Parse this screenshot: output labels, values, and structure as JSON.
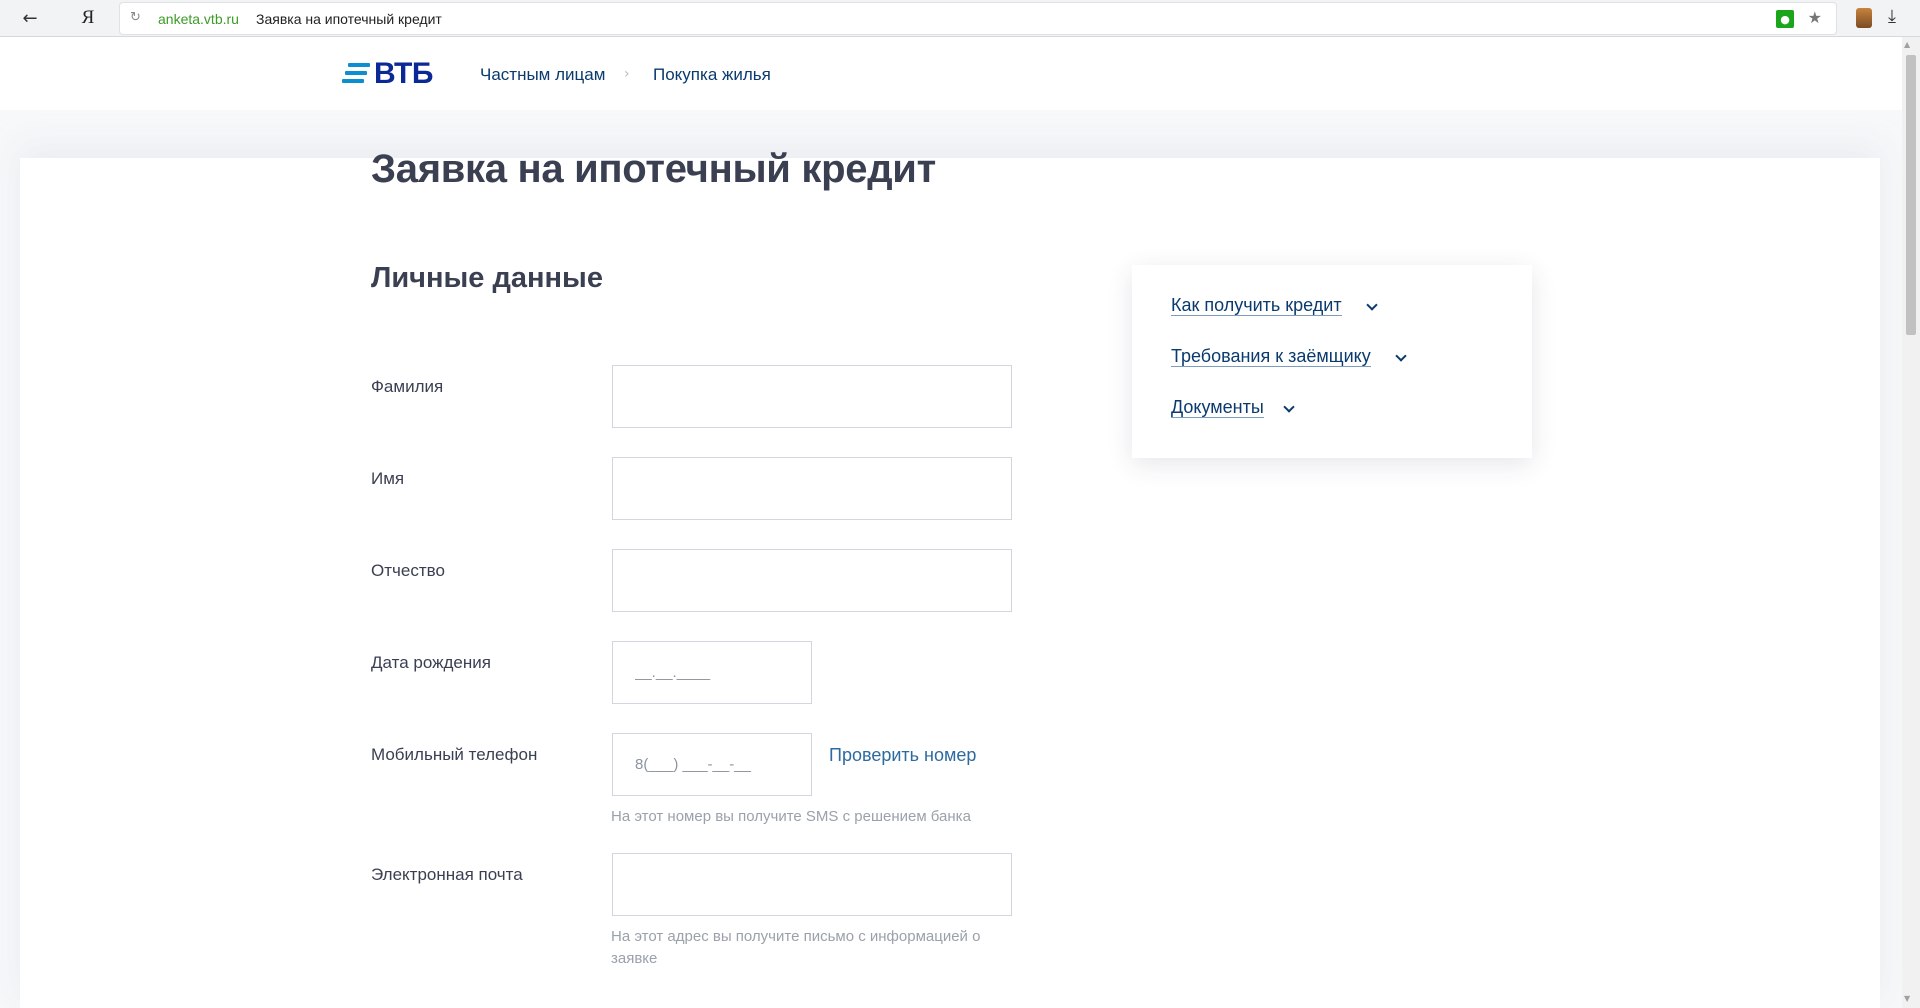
{
  "browser": {
    "back_icon": "←",
    "yandex_label": "Я",
    "reload_icon": "↻",
    "url_domain": "anketa.vtb.ru",
    "tab_title": "Заявка на ипотечный кредит",
    "lock_icon": "🔒",
    "star_icon": "★",
    "download_icon": "⤓"
  },
  "header": {
    "logo_text": "ВТБ",
    "logo_color": "#0a2896",
    "logo_bars_color": "#0a8fd0",
    "nav": [
      "Частным лицам",
      "Покупка жилья"
    ],
    "separator": "›"
  },
  "page": {
    "title": "Заявка на ипотечный кредит",
    "section_title": "Личные данные"
  },
  "form": {
    "last_name": {
      "label": "Фамилия",
      "value": ""
    },
    "first_name": {
      "label": "Имя",
      "value": ""
    },
    "middle_name": {
      "label": "Отчество",
      "value": ""
    },
    "birth_date": {
      "label": "Дата рождения",
      "placeholder": "__.__.____"
    },
    "phone": {
      "label": "Мобильный телефон",
      "placeholder": "8(___) ___-__-__",
      "verify_label": "Проверить номер",
      "hint": "На этот номер вы получите SMS с решением банка"
    },
    "email": {
      "label": "Электронная почта",
      "value": "",
      "hint": "На этот адрес вы получите письмо с информацией о заявке"
    }
  },
  "info_card": {
    "links": [
      "Как получить кредит",
      "Требования к заёмщику",
      "Документы"
    ]
  },
  "colors": {
    "text_dark": "#3a3f51",
    "link_blue": "#0a3a6e",
    "secondary_link": "#2d6aa0",
    "hint_gray": "#9aa1ab"
  }
}
